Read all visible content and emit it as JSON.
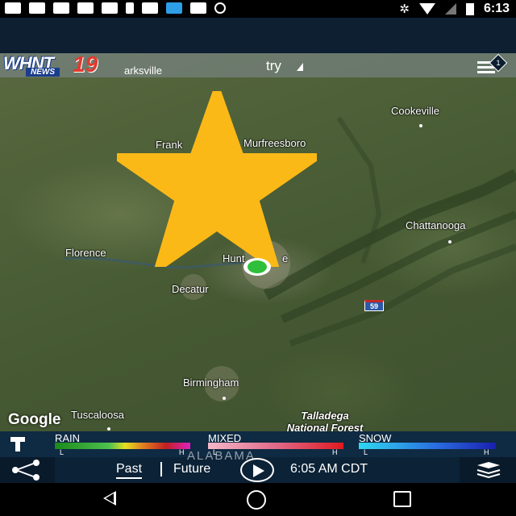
{
  "status_bar": {
    "time": "6:13",
    "icons": [
      "messaging-icon",
      "facebook-icon",
      "facebook-icon",
      "facebook-icon",
      "facebook-icon",
      "facebook-icon",
      "notification-icon",
      "mail-icon",
      "app-icon",
      "facebook-icon",
      "record-icon",
      "bluetooth-icon",
      "wifi-icon",
      "signal-icon",
      "battery-icon"
    ]
  },
  "header": {
    "logo_text": "WHNT",
    "logo_number": "19",
    "logo_sub": "NEWS",
    "partial_label": "arksville",
    "try_label": "try",
    "notification_count": "1"
  },
  "map": {
    "cities": [
      {
        "name": "Cookeville"
      },
      {
        "name": "Frank"
      },
      {
        "name": "Murfreesboro"
      },
      {
        "name": "Chattanooga"
      },
      {
        "name": "Florence"
      },
      {
        "name": "Hunt"
      },
      {
        "name": "e"
      },
      {
        "name": "Decatur"
      },
      {
        "name": "Birmingham"
      },
      {
        "name": "Tuscaloosa"
      }
    ],
    "forest_label_1": "Talladega",
    "forest_label_2": "National Forest",
    "state_label": "ALABAMA",
    "interstate": "59",
    "attribution": "Google"
  },
  "legend": {
    "rain": {
      "label": "RAIN",
      "low": "L",
      "high": "H"
    },
    "mixed": {
      "label": "MIXED",
      "low": "L",
      "high": "H"
    },
    "snow": {
      "label": "SNOW",
      "low": "L",
      "high": "H"
    }
  },
  "controls": {
    "past_label": "Past",
    "future_label": "Future",
    "time": "6:05 AM CDT"
  },
  "colors": {
    "star": "#fbb917",
    "marker": "#2fbf3a",
    "app_bar": "#0d1f31",
    "legend_bg": "#0f2a43"
  }
}
